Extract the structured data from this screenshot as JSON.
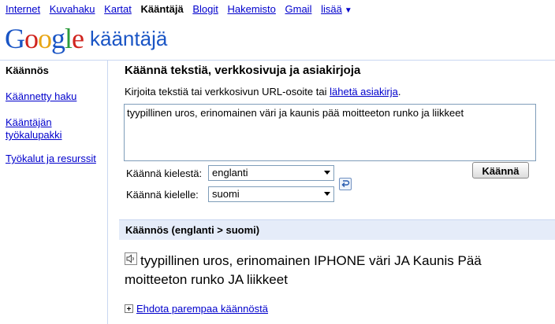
{
  "topnav": {
    "links": [
      "Internet",
      "Kuvahaku",
      "Kartat"
    ],
    "current": "Kääntäjä",
    "links_after": [
      "Blogit",
      "Hakemisto",
      "Gmail"
    ],
    "more": "lisää"
  },
  "logo": {
    "wordmark": "Google",
    "product": "kääntäjä"
  },
  "sidebar": {
    "current": "Käännös",
    "items": [
      "Käännetty haku",
      "Kääntäjän työkalupakki",
      "Työkalut ja resurssit"
    ]
  },
  "main": {
    "title": "Käännä tekstiä, verkkosivuja ja asiakirjoja",
    "instructions": "Kirjoita tekstiä tai verkkosivun URL-osoite tai",
    "upload_link": "lähetä asiakirja",
    "instructions_end": ".",
    "source_text": "tyypillinen uros, erinomainen väri ja kaunis pää moitteeton runko ja liikkeet",
    "from_label": "Käännä kielestä:",
    "from_value": "englanti",
    "to_label": "Käännä kielelle:",
    "to_value": "suomi",
    "translate_button": "Käännä"
  },
  "result": {
    "heading": "Käännös (englanti > suomi)",
    "text": "tyypillinen uros, erinomainen IPHONE väri JA Kaunis Pää moitteeton runko JA liikkeet",
    "suggest_link": "Ehdota parempaa käännöstä"
  },
  "colors": {
    "link": "#0000cc",
    "result_bar": "#e5ecf9",
    "rule": "#c9d7f1"
  }
}
